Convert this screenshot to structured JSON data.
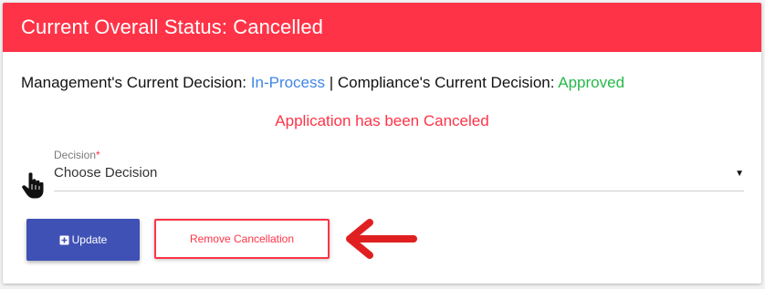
{
  "header": {
    "title": "Current Overall Status: Cancelled"
  },
  "decisions": {
    "management_label": "Management's Current Decision:",
    "management_value": "In-Process",
    "separator": "|",
    "compliance_label": "Compliance's Current Decision:",
    "compliance_value": "Approved"
  },
  "message": {
    "cancelled": "Application has been Canceled"
  },
  "decision_field": {
    "label": "Decision",
    "required_mark": "*",
    "value": "Choose Decision",
    "caret": "▼"
  },
  "buttons": {
    "update_label": "Update",
    "update_icon": "plus-square-icon",
    "remove_cancellation_label": "Remove Cancellation"
  },
  "colors": {
    "header_bg": "#ff3347",
    "management_value": "#3f86e6",
    "compliance_value": "#25b94a",
    "message": "#ff3347",
    "update_button": "#3f51b5",
    "remove_button_border": "#ff3347",
    "annotation_arrow": "#e02020"
  }
}
